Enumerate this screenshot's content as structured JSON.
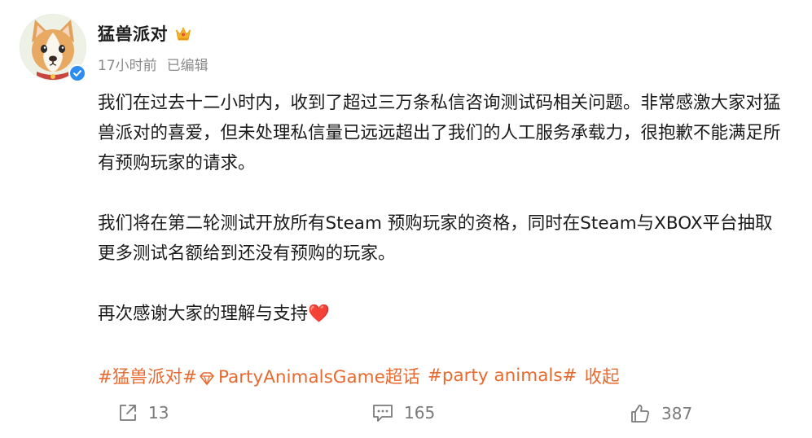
{
  "post": {
    "author": {
      "name": "猛兽派对",
      "avatar_icon": "corgi-avatar-icon",
      "verified_icon": "verified-check-icon",
      "badge_icon": "crown-badge-icon"
    },
    "meta": {
      "time": "17小时前",
      "edited": "已编辑"
    },
    "paragraphs": [
      "我们在过去十二小时内，收到了超过三万条私信咨询测试码相关问题。非常感激大家对猛兽派对的喜爱，但未处理私信量已远远超出了我们的人工服务承载力，很抱歉不能满足所有预购玩家的请求。",
      "我们将在第二轮测试开放所有Steam 预购玩家的资格，同时在Steam与XBOX平台抽取更多测试名额给到还没有预购的玩家。",
      "再次感谢大家的理解与支持❤️"
    ],
    "tags": {
      "topic1": "#猛兽派对#",
      "supertopic": "PartyAnimalsGame超话",
      "topic2": "#party animals#",
      "collapse": "收起"
    },
    "actions": {
      "share_count": "13",
      "comment_count": "165",
      "like_count": "387"
    },
    "colors": {
      "link": "#e86a2f",
      "meta": "#8a8a8a",
      "verified": "#2d8cf0"
    }
  }
}
